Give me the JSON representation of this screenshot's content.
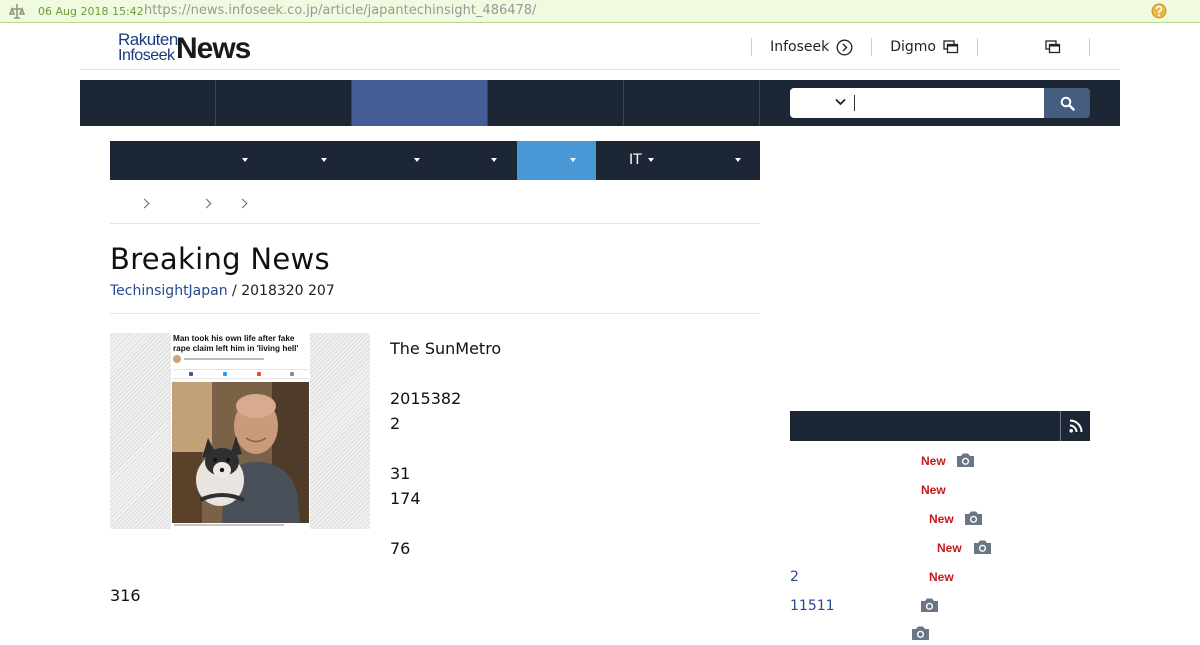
{
  "archive": {
    "date": "06 Aug 2018 15:42",
    "url": "https://news.infoseek.co.jp/article/japantechinsight_486478/"
  },
  "header": {
    "logo": {
      "line1": "Rakuten",
      "line2": "Infoseek",
      "word": "News"
    },
    "links": [
      {
        "label": "Infoseek",
        "icon": "circle-arrow-icon"
      },
      {
        "label": "Digmo",
        "icon": "external-window-icon"
      },
      {
        "label": "",
        "icon": "external-window-icon"
      }
    ]
  },
  "colors": {
    "nav_bg": "#1d2634",
    "nav_active": "#455d96",
    "category_active": "#4a97d5",
    "search_button": "#455d7e",
    "link_blue": "#244a8f",
    "new_badge": "#c8171e",
    "archive_bar": "#f0fade"
  },
  "category_nav": {
    "it_label": "IT"
  },
  "article": {
    "title": "Breaking News",
    "source": "TechinsightJapan",
    "date_line": " / 2018320 207",
    "image_headline": "Man took his own life after fake rape claim left him in 'living hell'",
    "paragraph_lines": [
      "The SunMetro",
      "",
      "2015382",
      "2",
      "",
      "31",
      "174",
      "",
      "76"
    ],
    "tail": "316"
  },
  "sidebar": {
    "rows": [
      {
        "num": "",
        "new": "New",
        "camera": true
      },
      {
        "num": "",
        "new": "New",
        "camera": false
      },
      {
        "num": "",
        "new": "New",
        "camera": true
      },
      {
        "num": "",
        "new": "New",
        "camera": true
      },
      {
        "num": "2",
        "new": "New",
        "camera": false
      },
      {
        "num": "11511",
        "new": "",
        "camera": true
      }
    ]
  }
}
